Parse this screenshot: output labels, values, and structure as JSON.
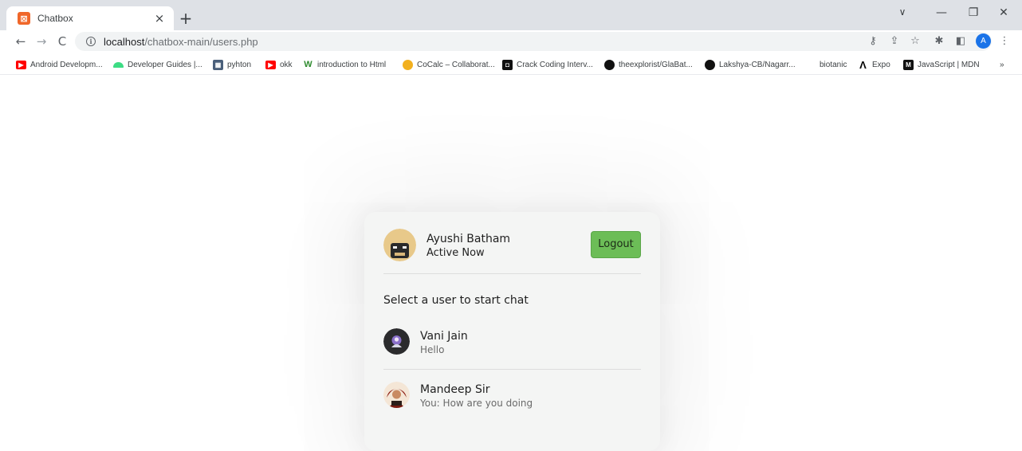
{
  "browser": {
    "tab": {
      "title": "Chatbox",
      "close": "×",
      "favicon": "XAMPP"
    },
    "newtab": "+",
    "window": {
      "dropdown": "∨",
      "minimize": "—",
      "restore": "❐",
      "close": "✕"
    },
    "nav": {
      "back": "←",
      "forward": "→",
      "reload": "C"
    },
    "url": {
      "host": "localhost",
      "path": "/chatbox-main/users.php"
    },
    "profile_initial": "A"
  },
  "bookmarks": [
    {
      "label": "Android Developm...",
      "icon": "youtube-icon",
      "color": "#ff0000"
    },
    {
      "label": "Developer Guides |...",
      "icon": "android-icon",
      "color": "#3ddc84"
    },
    {
      "label": "pyhton",
      "icon": "grid-icon",
      "color": "#4a5f7a"
    },
    {
      "label": "okk",
      "icon": "youtube-icon",
      "color": "#ff0000"
    },
    {
      "label": "introduction to Html",
      "icon": "w3-icon",
      "color": "#2e8b2e"
    },
    {
      "label": "CoCalc – Collaborat...",
      "icon": "cocalc-icon",
      "color": "#f2b01e"
    },
    {
      "label": "Crack Coding Interv...",
      "icon": "coding-icon",
      "color": "#111111"
    },
    {
      "label": "theexplorist/GlaBat...",
      "icon": "github-icon",
      "color": "#111111"
    },
    {
      "label": "Lakshya-CB/Nagarr...",
      "icon": "github-icon",
      "color": "#111111"
    },
    {
      "label": "biotanic",
      "icon": "",
      "color": "#ffffff"
    },
    {
      "label": "Expo",
      "icon": "expo-icon",
      "color": "#000000"
    },
    {
      "label": "JavaScript | MDN",
      "icon": "mdn-icon",
      "color": "#111111"
    }
  ],
  "bookmarks_more": "»",
  "chat": {
    "current_user": {
      "name": "Ayushi Batham",
      "status": "Active Now"
    },
    "logout_label": "Logout",
    "select_prompt": "Select a user to start chat",
    "users": [
      {
        "name": "Vani Jain",
        "last_message": "Hello"
      },
      {
        "name": "Mandeep Sir",
        "last_message": "You: How are you doing"
      }
    ],
    "colors": {
      "logout_bg": "#6cbd57",
      "card_bg": "#f4f5f4"
    }
  }
}
